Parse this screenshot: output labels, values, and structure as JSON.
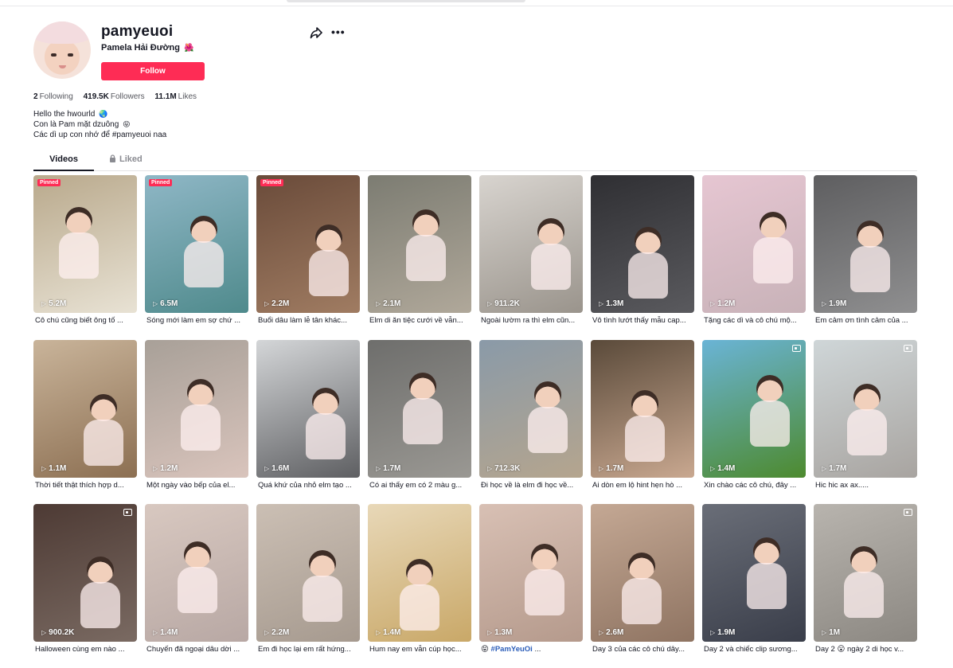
{
  "profile": {
    "username": "pamyeuoi",
    "nickname": "Pamela Hải Đường",
    "nickname_icon": "🌺",
    "follow_label": "Follow",
    "stats": {
      "following": "2",
      "following_label": "Following",
      "followers": "419.5K",
      "followers_label": "Followers",
      "likes": "11.1M",
      "likes_label": "Likes"
    },
    "bio": [
      {
        "text": "Hello the hwourld",
        "icon": "🌏"
      },
      {
        "text": "Con là Pam mặt dzuông",
        "icon": "😝"
      },
      {
        "text": "Các dì up con nhớ để #pamyeuoi naa",
        "icon": ""
      }
    ]
  },
  "tabs": {
    "videos": "Videos",
    "liked": "Liked"
  },
  "videos": [
    {
      "views": "5.2M",
      "caption": "Cô chú cũng biết ông tố ...",
      "pinned": "Pinned",
      "bg": [
        "#b9a98c",
        "#e8e2d4"
      ]
    },
    {
      "views": "6.5M",
      "caption": "Sóng mới làm em sợ chứ ...",
      "pinned": "Pinned",
      "bg": [
        "#8fb7c6",
        "#4f8a8c"
      ]
    },
    {
      "views": "2.2M",
      "caption": "Buổi dâu làm lễ tân khác...",
      "pinned": "Pinned",
      "bg": [
        "#6a4b3a",
        "#a07c62"
      ]
    },
    {
      "views": "2.1M",
      "caption": "Elm di ăn tiệc cưới về vẫn...",
      "bg": [
        "#7c7c72",
        "#b0a89a"
      ]
    },
    {
      "views": "911.2K",
      "caption": "Ngoài lườm ra thì elm cũn...",
      "bg": [
        "#d8d4cf",
        "#9a948c"
      ]
    },
    {
      "views": "1.3M",
      "caption": "Vô tình lướt thấy mẫu cap...",
      "bg": [
        "#2f2f33",
        "#5a5a5e"
      ]
    },
    {
      "views": "1.2M",
      "caption": "Tặng các dì và cô chú mộ...",
      "bg": [
        "#e6c6d2",
        "#c8b2b8"
      ]
    },
    {
      "views": "1.9M",
      "caption": "Em cảm ơn tình cảm của ...",
      "bg": [
        "#5e5e60",
        "#8f8f90"
      ]
    },
    {
      "views": "1.1M",
      "caption": "Thời tiết thật thích hợp d...",
      "bg": [
        "#c9b49a",
        "#8c6f52"
      ]
    },
    {
      "views": "1.2M",
      "caption": "Một ngày vào bếp của el...",
      "bg": [
        "#a8a098",
        "#d9c4bc"
      ]
    },
    {
      "views": "1.6M",
      "caption": "Quá khứ của nhỏ elm tạo ...",
      "bg": [
        "#d4d6d8",
        "#5e5f62"
      ]
    },
    {
      "views": "1.7M",
      "caption": "Có ai thấy em có 2 màu g...",
      "bg": [
        "#6e6e6c",
        "#9a9893"
      ]
    },
    {
      "views": "712.3K",
      "caption": "Đi học về là elm đi học về...",
      "bg": [
        "#8a9aa8",
        "#b5a58e"
      ]
    },
    {
      "views": "1.7M",
      "caption": "Ai dòn em lộ hint hẹn hò ...",
      "bg": [
        "#5a4a3a",
        "#c9a890"
      ]
    },
    {
      "views": "1.4M",
      "caption": "Xin chào các cô chú, đây ...",
      "photo": true,
      "bg": [
        "#6ab4d6",
        "#4d8a2e"
      ]
    },
    {
      "views": "1.7M",
      "caption": "Hic hic ax ax.....",
      "photo": true,
      "bg": [
        "#cfd6d8",
        "#a8a4a0"
      ]
    },
    {
      "views": "900.2K",
      "caption": "Halloween cùng em nào ...",
      "photo": true,
      "bg": [
        "#4d3a34",
        "#7a6a62"
      ]
    },
    {
      "views": "1.4M",
      "caption": "Chuyến đã ngoại dâu dời ...",
      "bg": [
        "#d8c8c0",
        "#b8a8a4"
      ]
    },
    {
      "views": "2.2M",
      "caption": "Em đi học lại em rất hứng...",
      "bg": [
        "#cbbfb4",
        "#a69a8f"
      ]
    },
    {
      "views": "1.4M",
      "caption": "Hum nay em vẫn cúp học...",
      "bg": [
        "#e8d8b8",
        "#c9a868"
      ]
    },
    {
      "views": "1.3M",
      "caption": "😝 #PamYeuOi ...",
      "hashtag": true,
      "bg": [
        "#d8c0b4",
        "#b59a8c"
      ]
    },
    {
      "views": "2.6M",
      "caption": "Day 3 của các cô chú dây...",
      "bg": [
        "#c4a894",
        "#8f7462"
      ]
    },
    {
      "views": "1.9M",
      "caption": "Day 2 và chiếc clip sương...",
      "bg": [
        "#6a6e78",
        "#3a3e4a"
      ]
    },
    {
      "views": "1M",
      "caption": "Day 2 😮 ngày 2 di học v...",
      "photo": true,
      "bg": [
        "#b8b4ae",
        "#8c8882"
      ]
    }
  ]
}
